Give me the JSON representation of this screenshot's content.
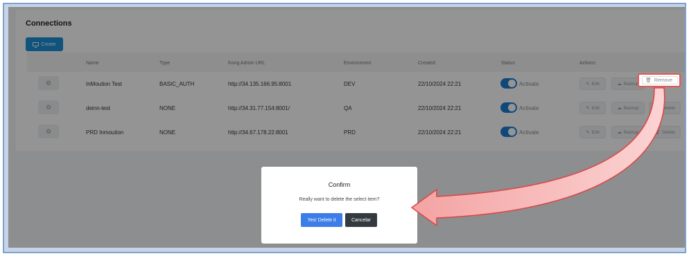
{
  "page": {
    "title": "Connections"
  },
  "toolbar": {
    "create_label": "Create"
  },
  "table": {
    "headers": [
      "Name",
      "Type",
      "Kong Admin URL",
      "Environment",
      "Created",
      "Status",
      "Actions"
    ],
    "rows": [
      {
        "name": "InMoution Test",
        "type": "BASIC_AUTH",
        "url": "http://34.135.166.95:8001",
        "env": "DEV",
        "created": "22/10/2024 22:21",
        "status": "Activate",
        "active": true
      },
      {
        "name": "deinn-test",
        "type": "NONE",
        "url": "http://34.31.77.154:8001/",
        "env": "QA",
        "created": "22/10/2024 22:21",
        "status": "Activate",
        "active": true
      },
      {
        "name": "PRD Inmoution",
        "type": "NONE",
        "url": "http://34.67.178.22:8001",
        "env": "PRD",
        "created": "22/10/2024 22:21",
        "status": "Activate",
        "active": true
      }
    ],
    "actions": {
      "edit": "Edit",
      "backup": "Backup",
      "delete": "Delete",
      "remove": "Remove"
    }
  },
  "dialog": {
    "title": "Confirm",
    "message": "Really want to delete the select item?",
    "confirm_label": "Yes! Delete it",
    "cancel_label": "Cancelar"
  },
  "colors": {
    "primary": "#1d8fd6",
    "confirm": "#3d7de8",
    "cancel": "#343a40",
    "annotation": "#e35656"
  }
}
